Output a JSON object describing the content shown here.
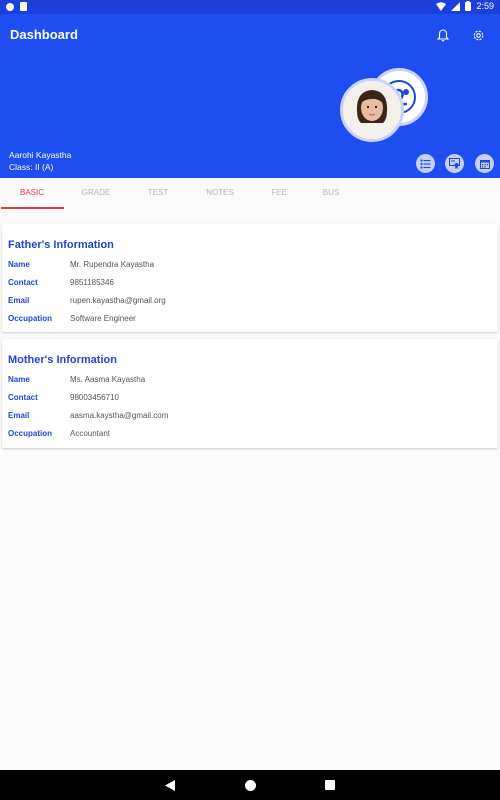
{
  "status_bar": {
    "time": "2:59"
  },
  "appbar": {
    "title": "Dashboard",
    "icons": [
      "bell-icon",
      "settings-icon"
    ]
  },
  "student": {
    "name": "Aarohi Kayastha",
    "class_label": "Class: II (A)"
  },
  "header_actions": [
    "list-icon",
    "certificate-icon",
    "calendar-icon"
  ],
  "tabs": [
    {
      "label": "BASIC",
      "active": true
    },
    {
      "label": "GRADE",
      "active": false
    },
    {
      "label": "TEST",
      "active": false
    },
    {
      "label": "NOTES",
      "active": false
    },
    {
      "label": "FEE",
      "active": false
    },
    {
      "label": "BUS",
      "active": false
    }
  ],
  "father": {
    "title": "Father's Information",
    "rows": [
      {
        "label": "Name",
        "value": "Mr. Rupendra Kayastha"
      },
      {
        "label": "Contact",
        "value": "9851185346"
      },
      {
        "label": "Email",
        "value": "rupen.kayastha@gmail.org"
      },
      {
        "label": "Occupation",
        "value": "Software Engineer"
      }
    ]
  },
  "mother": {
    "title": "Mother's Information",
    "rows": [
      {
        "label": "Name",
        "value": "Ms. Aasma Kayastha"
      },
      {
        "label": "Contact",
        "value": "98003456710"
      },
      {
        "label": "Email",
        "value": "aasma.kaystha@gmail.com"
      },
      {
        "label": "Occupation",
        "value": "Accountant"
      }
    ]
  },
  "colors": {
    "primary": "#1f4ef0",
    "accent": "#e53950",
    "label": "#1f46d8"
  }
}
